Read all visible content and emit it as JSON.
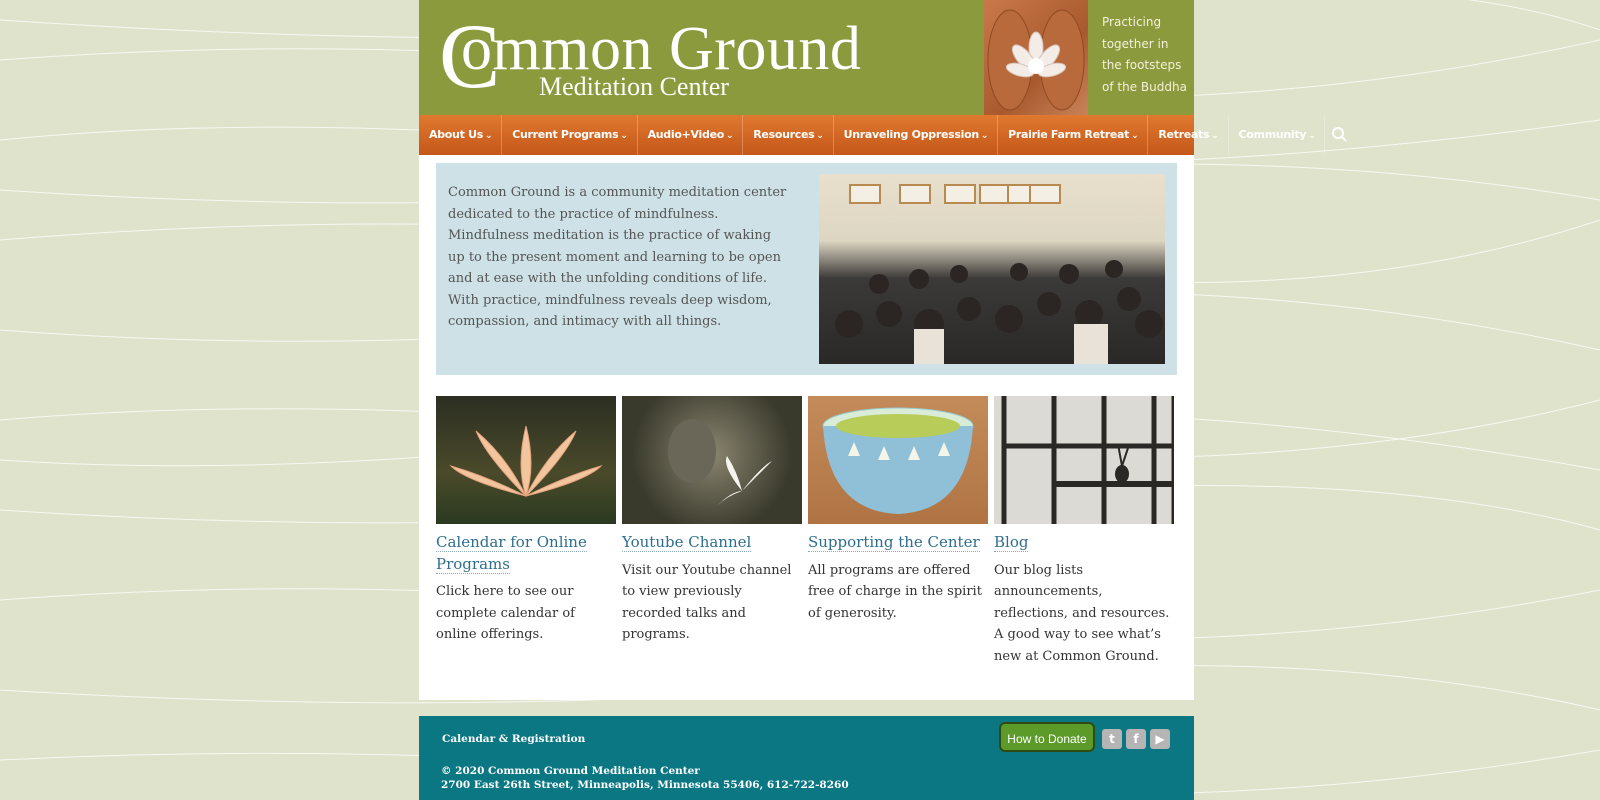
{
  "header": {
    "logo_main": "ommon Ground",
    "logo_big_letter": "C",
    "logo_sub": "Meditation Center",
    "tagline": [
      "Practicing",
      "together in",
      "the footsteps",
      "of the Buddha"
    ]
  },
  "nav": {
    "items": [
      {
        "label": "About Us"
      },
      {
        "label": "Current Programs"
      },
      {
        "label": "Audio+Video"
      },
      {
        "label": "Resources"
      },
      {
        "label": "Unraveling Oppression"
      },
      {
        "label": "Prairie Farm Retreat"
      },
      {
        "label": "Retreats"
      },
      {
        "label": "Community"
      }
    ],
    "chevron": "⌄"
  },
  "intro": {
    "text": "Common Ground is a community meditation center dedicated to the practice of mindfulness. Mindfulness meditation is the practice of waking up to the present moment and learning to be open and at ease with the unfolding conditions of life. With practice, mindfulness reveals deep wisdom, compassion, and intimacy with all things."
  },
  "cards": [
    {
      "title": "Calendar for Online Programs",
      "text": "Click here to see our complete calendar of online offerings."
    },
    {
      "title": "Youtube Channel",
      "text": "Visit our Youtube channel to view previously recorded talks and programs."
    },
    {
      "title": "Supporting the Center",
      "text": "All programs are offered free of charge in the spirit of generosity."
    },
    {
      "title": "Blog",
      "text": "Our blog lists announcements, reflections, and resources. A good way to see what’s new at Common Ground."
    }
  ],
  "footer": {
    "link": "Calendar & Registration",
    "donate_label": "How to Donate",
    "social": {
      "twitter": "t",
      "facebook": "f",
      "youtube": "▶"
    },
    "copyright": "© 2020 Common Ground Meditation Center",
    "address": "2700 East 26th Street, Minneapolis, Minnesota 55406, 612-722-8260"
  },
  "colors": {
    "header_green": "#8a9a3d",
    "nav_orange": "#d9682a",
    "intro_blue": "#cde1e6",
    "footer_teal": "#0a7783",
    "link_blue": "#2e6e8e",
    "donate_green": "#5c9b2a"
  }
}
